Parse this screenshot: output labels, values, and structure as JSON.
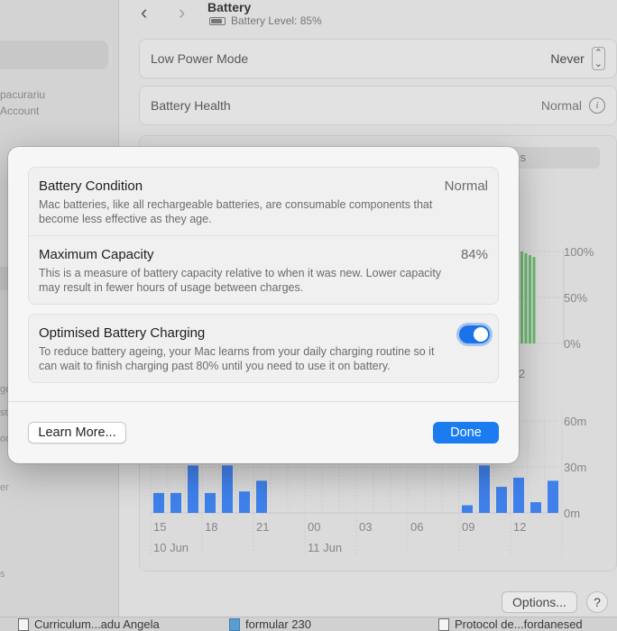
{
  "window": {
    "title": "Battery",
    "subtitle": "Battery Level: 85%"
  },
  "sidebar": {
    "user_name_fragment": "pacurariu",
    "user_account_fragment": "Account",
    "frag_1": "ge",
    "frag_2": "str",
    "frag_3": "oo",
    "frag_4": "er",
    "frag_5": "s"
  },
  "settings": {
    "low_power_mode": {
      "label": "Low Power Mode",
      "value": "Never"
    },
    "battery_health": {
      "label": "Battery Health",
      "value": "Normal"
    },
    "segment_fragment": "s"
  },
  "charts": {
    "level_chart": {
      "type": "bar",
      "y_ticks": [
        "100%",
        "50%",
        "0%"
      ],
      "x_tick_fragment": "2",
      "values": [
        100,
        98,
        96,
        94
      ],
      "ylim": [
        0,
        100
      ],
      "bar_color": "#6cc070"
    },
    "usage_chart": {
      "type": "bar",
      "y_ticks": [
        "60m",
        "30m",
        "0m"
      ],
      "x_ticks": [
        "15",
        "18",
        "21",
        "00",
        "03",
        "06",
        "09",
        "12"
      ],
      "date_labels": [
        "10 Jun",
        "11 Jun"
      ],
      "ylim": [
        0,
        60
      ],
      "left_values": [
        13,
        13,
        31,
        13,
        31,
        14,
        21
      ],
      "right_values": [
        5,
        31,
        17,
        23,
        7,
        21
      ],
      "bar_color": "#3b82f6"
    }
  },
  "footer": {
    "options_label": "Options...",
    "help_label": "?"
  },
  "dock": {
    "item_1": "Curriculum...adu Angela",
    "item_2": "formular 230",
    "item_3": "Protocol de...fordanesed"
  },
  "modal": {
    "battery_condition": {
      "title": "Battery Condition",
      "value": "Normal",
      "description": "Mac batteries, like all rechargeable batteries, are consumable components that become less effective as they age."
    },
    "maximum_capacity": {
      "title": "Maximum Capacity",
      "value": "84%",
      "description": "This is a measure of battery capacity relative to when it was new. Lower capacity may result in fewer hours of usage between charges."
    },
    "optimised_charging": {
      "title": "Optimised Battery Charging",
      "enabled": true,
      "description": "To reduce battery ageing, your Mac learns from your daily charging routine so it can wait to finish charging past 80% until you need to use it on battery."
    },
    "learn_more_label": "Learn More...",
    "done_label": "Done",
    "accent_color": "#1a7cf0"
  }
}
